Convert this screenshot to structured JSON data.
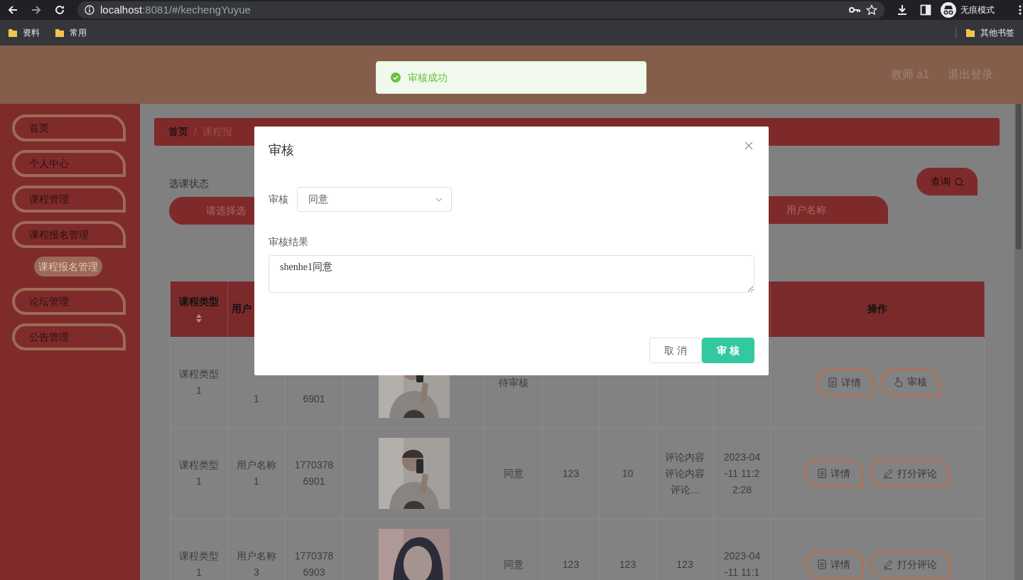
{
  "browser": {
    "url_host": "localhost",
    "url_path": ":8081/#/kechengYuyue",
    "profile_label": "无痕模式",
    "bookmarks": [
      "资料",
      "常用"
    ],
    "other_bookmarks": "其他书签"
  },
  "header": {
    "user": "教师 a1",
    "logout": "退出登录"
  },
  "toast": {
    "kind": "success",
    "message": "审核成功"
  },
  "sidebar": {
    "items": [
      {
        "label": "首页",
        "kind": "link"
      },
      {
        "label": "个人中心",
        "kind": "menu"
      },
      {
        "label": "课程管理",
        "kind": "menu"
      },
      {
        "label": "课程报名管理",
        "kind": "menu",
        "children": [
          {
            "label": "课程报名管理",
            "selected": true
          }
        ]
      },
      {
        "label": "论坛管理",
        "kind": "menu"
      },
      {
        "label": "公告管理",
        "kind": "menu"
      }
    ]
  },
  "breadcrumb": [
    "首页",
    "课程报"
  ],
  "breadcrumb_separator": "/",
  "search": {
    "status_label": "选课状态",
    "status_placeholder": "请选择选",
    "username_placeholder": "用户名称",
    "query_button": "查询"
  },
  "table": {
    "columns": [
      {
        "label": "课程类型",
        "sortable": true
      },
      {
        "label": "用户",
        "sortable": false
      }
    ],
    "actions_header": "操作",
    "rows": [
      {
        "cells": [
          {
            "kind": "text",
            "text": "课程类型1"
          },
          {
            "kind": "partial",
            "text": "1"
          },
          {
            "kind": "partial",
            "text": "6901"
          },
          {
            "kind": "picture"
          },
          {
            "kind": "text",
            "text": "待审核"
          },
          {
            "kind": "empty"
          },
          {
            "kind": "empty"
          },
          {
            "kind": "empty"
          },
          {
            "kind": "empty"
          }
        ],
        "actions": [
          {
            "label": "详情",
            "kind": "detail"
          },
          {
            "label": "审核",
            "kind": "review"
          }
        ]
      },
      {
        "cells": [
          {
            "kind": "text",
            "text": "课程类型1"
          },
          {
            "kind": "text",
            "text": "用户名称1"
          },
          {
            "kind": "text",
            "text": "17703786901"
          },
          {
            "kind": "picture"
          },
          {
            "kind": "text",
            "text": "同意"
          },
          {
            "kind": "text",
            "text": "123"
          },
          {
            "kind": "text",
            "text": "10"
          },
          {
            "kind": "text",
            "text": "评论内容评论内容评论..."
          },
          {
            "kind": "text",
            "text": "2023-04-11 11:22:28"
          }
        ],
        "actions": [
          {
            "label": "详情",
            "kind": "detail"
          },
          {
            "label": "打分评论",
            "kind": "rate"
          }
        ]
      },
      {
        "cells": [
          {
            "kind": "text",
            "text": "课程类型1"
          },
          {
            "kind": "text",
            "text": "用户名称3"
          },
          {
            "kind": "text",
            "text": "17703786903"
          },
          {
            "kind": "picture"
          },
          {
            "kind": "text",
            "text": "同意"
          },
          {
            "kind": "text",
            "text": "123"
          },
          {
            "kind": "text",
            "text": "123"
          },
          {
            "kind": "text",
            "text": "123"
          },
          {
            "kind": "text",
            "text": "2023-04-11 11:1"
          }
        ],
        "actions": [
          {
            "label": "详情",
            "kind": "detail"
          },
          {
            "label": "打分评论",
            "kind": "rate"
          }
        ]
      }
    ]
  },
  "modal": {
    "title": "审核",
    "select_label": "审核",
    "select_value": "同意",
    "result_label": "审核结果",
    "result_value": "shenhe1同意",
    "buttons": [
      {
        "label": "取消",
        "kind": "default"
      },
      {
        "label": "审核",
        "kind": "primary"
      }
    ]
  }
}
